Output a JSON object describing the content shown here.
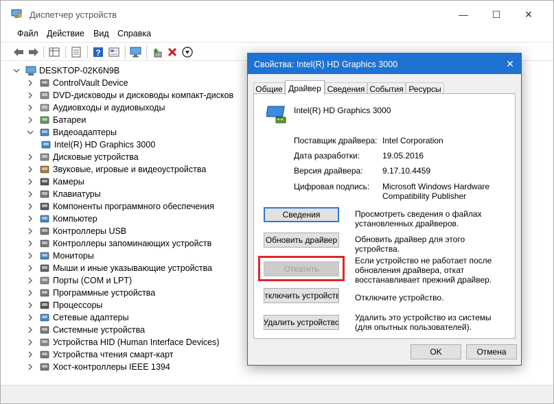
{
  "window": {
    "title": "Диспетчер устройств",
    "minimize_glyph": "—",
    "maximize_glyph": "☐",
    "close_glyph": "✕"
  },
  "menu": [
    "Файл",
    "Действие",
    "Вид",
    "Справка"
  ],
  "toolbar": {
    "icons": [
      "back-arrow-icon",
      "forward-arrow-icon",
      "properties-grid-icon",
      "properties-sheet-icon",
      "help-icon",
      "view-icon",
      "monitor-scan-icon",
      "update-driver-icon",
      "uninstall-x-icon",
      "disable-down-icon"
    ]
  },
  "tree": {
    "root": "DESKTOP-02K6N9B",
    "items": [
      {
        "label": "ControlVault Device",
        "expanded": false
      },
      {
        "label": "DVD-дисководы и дисководы компакт-дисков",
        "expanded": false
      },
      {
        "label": "Аудиовходы и аудиовыходы",
        "expanded": false
      },
      {
        "label": "Батареи",
        "expanded": false
      },
      {
        "label": "Видеоадаптеры",
        "expanded": true
      },
      {
        "label": "Intel(R) HD Graphics 3000",
        "child": true
      },
      {
        "label": "Дисковые устройства",
        "expanded": false
      },
      {
        "label": "Звуковые, игровые и видеоустройства",
        "expanded": false
      },
      {
        "label": "Камеры",
        "expanded": false
      },
      {
        "label": "Клавиатуры",
        "expanded": false
      },
      {
        "label": "Компоненты программного обеспечения",
        "expanded": false
      },
      {
        "label": "Компьютер",
        "expanded": false
      },
      {
        "label": "Контроллеры USB",
        "expanded": false
      },
      {
        "label": "Контроллеры запоминающих устройств",
        "expanded": false
      },
      {
        "label": "Мониторы",
        "expanded": false
      },
      {
        "label": "Мыши и иные указывающие устройства",
        "expanded": false
      },
      {
        "label": "Порты (COM и LPT)",
        "expanded": false
      },
      {
        "label": "Программные устройства",
        "expanded": false
      },
      {
        "label": "Процессоры",
        "expanded": false
      },
      {
        "label": "Сетевые адаптеры",
        "expanded": false
      },
      {
        "label": "Системные устройства",
        "expanded": false
      },
      {
        "label": "Устройства HID (Human Interface Devices)",
        "expanded": false
      },
      {
        "label": "Устройства чтения смарт-карт",
        "expanded": false
      },
      {
        "label": "Хост-контроллеры IEEE 1394",
        "expanded": false
      }
    ]
  },
  "dialog": {
    "title": "Свойства: Intel(R) HD Graphics 3000",
    "close_glyph": "✕",
    "tabs": [
      "Общие",
      "Драйвер",
      "Сведения",
      "События",
      "Ресурсы"
    ],
    "active_tab": "Драйвер",
    "device_name": "Intel(R) HD Graphics 3000",
    "info": [
      {
        "label": "Поставщик драйвера:",
        "value": "Intel Corporation"
      },
      {
        "label": "Дата разработки:",
        "value": "19.05.2016"
      },
      {
        "label": "Версия драйвера:",
        "value": "9.17.10.4459"
      },
      {
        "label": "Цифровая подпись:",
        "value": "Microsoft Windows Hardware Compatibility Publisher"
      }
    ],
    "actions": [
      {
        "button": "Сведения",
        "desc": "Просмотреть сведения о файлах установленных драйверов.",
        "state": "default"
      },
      {
        "button": "Обновить драйвер",
        "desc": "Обновить драйвер для этого устройства.",
        "state": "normal"
      },
      {
        "button": "Откатить",
        "desc": "Если устройство не работает после обновления драйвера, откат восстанавливает прежний драйвер.",
        "state": "disabled"
      },
      {
        "button": "Отключить устройство",
        "desc": "Отключите устройство.",
        "state": "normal"
      },
      {
        "button": "Удалить устройство",
        "desc": "Удалить это устройство из системы (для опытных пользователей).",
        "state": "normal"
      }
    ],
    "ok_label": "OK",
    "cancel_label": "Отмена"
  },
  "colors": {
    "dialog_title_bg": "#1e73d2",
    "highlight_border": "#e0262a",
    "default_button_border": "#2c78d4"
  }
}
